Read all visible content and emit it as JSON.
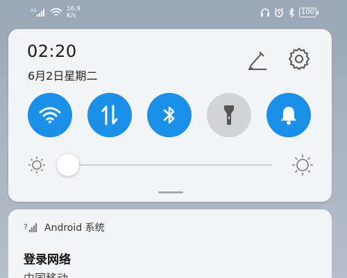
{
  "status_bar": {
    "network_label": "2G",
    "speed_value": "16.9",
    "speed_unit": "K/s",
    "battery": "100",
    "icons": [
      "headphones-icon",
      "alarm-icon",
      "bluetooth-icon",
      "battery-icon"
    ]
  },
  "quick_panel": {
    "time": "02:20",
    "date": "6月2日星期二",
    "edit_icon": "pencil-icon",
    "settings_icon": "gear-icon",
    "toggles": [
      {
        "icon": "wifi-icon",
        "state": "on"
      },
      {
        "icon": "mobile-data-icon",
        "state": "on"
      },
      {
        "icon": "bluetooth-icon",
        "state": "on"
      },
      {
        "icon": "flashlight-icon",
        "state": "off"
      },
      {
        "icon": "bell-icon",
        "state": "on"
      }
    ],
    "brightness_level": 0.0,
    "colors": {
      "accent": "#1c8fe8",
      "off": "#d2d3d6",
      "panel": "#f3f4f6"
    }
  },
  "notification": {
    "app_name": "Android 系统",
    "title": "登录网络",
    "subtitle": "中国移动"
  }
}
